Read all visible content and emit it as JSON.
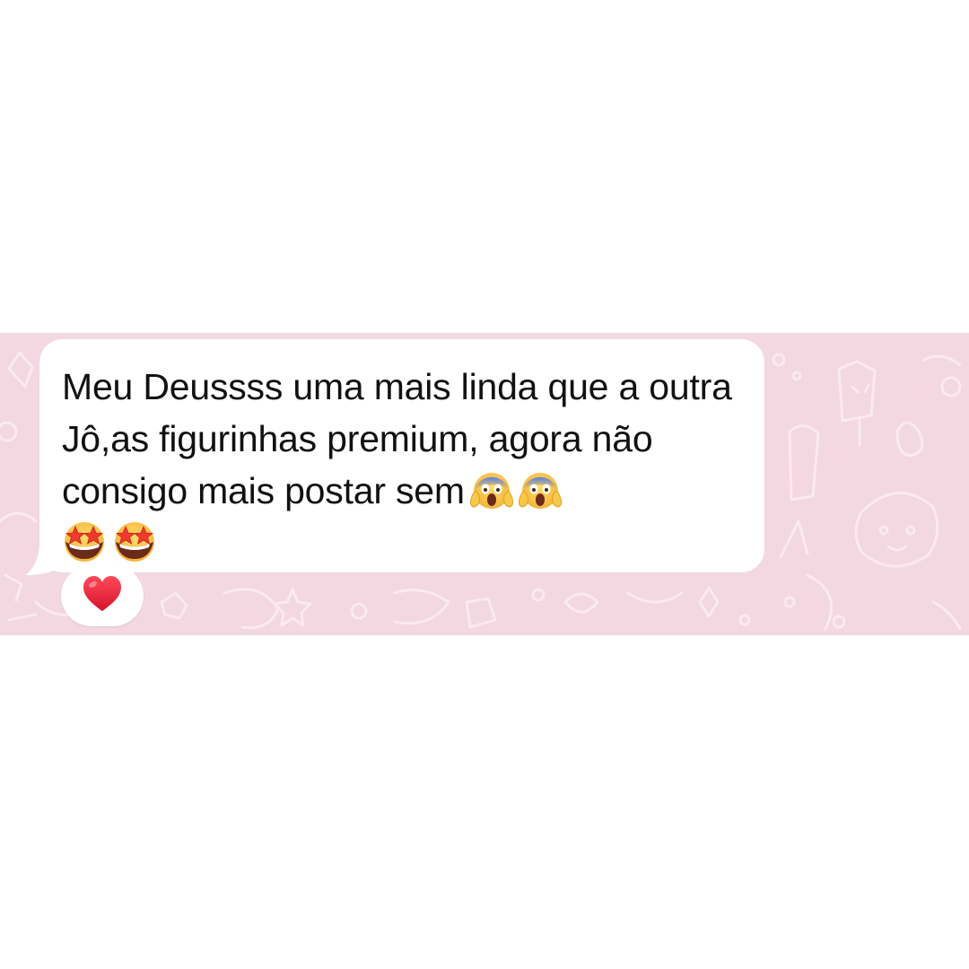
{
  "colors": {
    "chat_background": "#f3d7e1",
    "doodle_stroke": "#fbeaf0",
    "bubble": "#ffffff",
    "text": "#111111",
    "reaction_heart": "#e0192f"
  },
  "message": {
    "text_part": "Meu Deussss uma mais linda que a outra Jô,as figurinhas premium, agora não consigo mais postar sem",
    "emojis": [
      "face-screaming-in-fear",
      "face-screaming-in-fear",
      "star-struck",
      "star-struck"
    ]
  },
  "reaction": {
    "emoji": "red-heart"
  }
}
